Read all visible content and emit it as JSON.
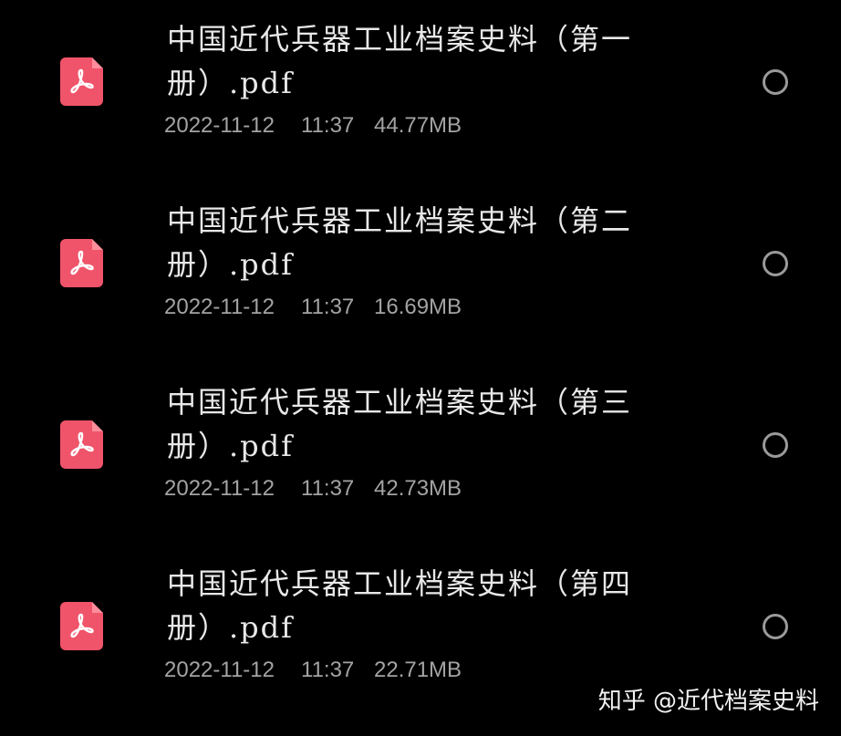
{
  "files": [
    {
      "name": "中国近代兵器工业档案史料（第一册）.pdf",
      "date": "2022-11-12",
      "time": "11:37",
      "size": "44.77MB",
      "icon": "pdf-file-icon"
    },
    {
      "name": "中国近代兵器工业档案史料（第二册）.pdf",
      "date": "2022-11-12",
      "time": "11:37",
      "size": "16.69MB",
      "icon": "pdf-file-icon"
    },
    {
      "name": "中国近代兵器工业档案史料（第三册）.pdf",
      "date": "2022-11-12",
      "time": "11:37",
      "size": "42.73MB",
      "icon": "pdf-file-icon"
    },
    {
      "name": "中国近代兵器工业档案史料（第四册）.pdf",
      "date": "2022-11-12",
      "time": "11:37",
      "size": "22.71MB",
      "icon": "pdf-file-icon"
    }
  ],
  "watermark": "知乎 @近代档案史料",
  "colors": {
    "background": "#000000",
    "pdf_icon": "#f0546a",
    "file_name": "#e8e8e8",
    "meta_text": "#a3a3a3",
    "radio_border": "#9a9a9a"
  }
}
